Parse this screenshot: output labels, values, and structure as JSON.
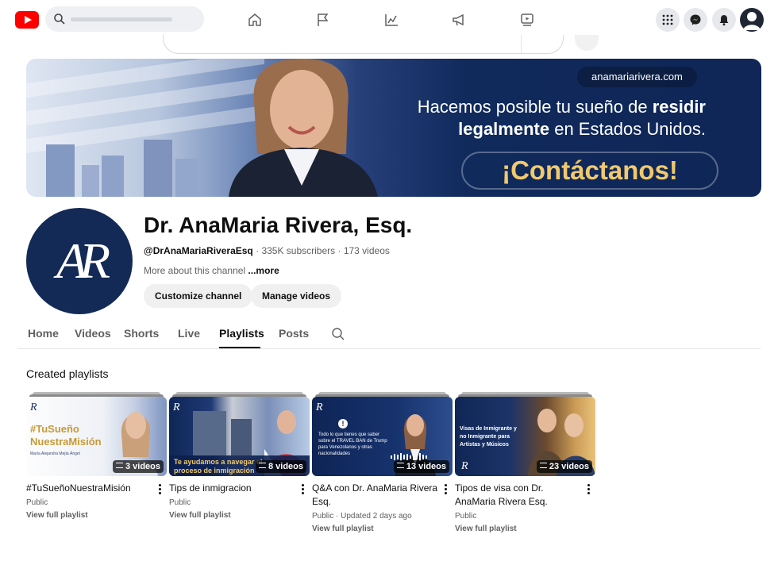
{
  "topbar": {
    "icons": [
      "youtube-logo",
      "search-icon",
      "home-icon",
      "flag-icon",
      "analytics-icon",
      "megaphone-icon",
      "video-icon",
      "apps-grid-icon",
      "messenger-icon",
      "bell-icon",
      "account-icon"
    ]
  },
  "banner": {
    "url": "anamariarivera.com",
    "line1_pre": "Hacemos posible tu sueño de ",
    "line1_bold": "residir",
    "line2_bold": "legalmente",
    "line2_post": " en Estados Unidos.",
    "cta": "¡Contáctanos!"
  },
  "channel": {
    "avatar_letters": "AR",
    "name": "Dr. AnaMaria Rivera, Esq.",
    "handle": "@DrAnaMariaRiveraEsq",
    "separator": " · ",
    "subscribers": "335K subscribers",
    "videos": "173 videos",
    "more_prefix": "More about this channel ",
    "more_link": "...more",
    "customize_label": "Customize channel",
    "manage_label": "Manage videos"
  },
  "tabs": [
    {
      "label": "Home"
    },
    {
      "label": "Videos"
    },
    {
      "label": "Shorts"
    },
    {
      "label": "Live"
    },
    {
      "label": "Playlists"
    },
    {
      "label": "Posts"
    }
  ],
  "active_tab": "Playlists",
  "section_title": "Created playlists",
  "playlists": [
    {
      "title": "#TuSueñoNuestraMisión",
      "visibility": "Public",
      "updated": "",
      "count": "3 videos",
      "link": "View full playlist",
      "thumb_text": "#TuSueño NuestraMisión",
      "thumb_sub": "María Alejandra Mejía Ángel"
    },
    {
      "title": "Tips de inmigracion",
      "visibility": "Public",
      "updated": "",
      "count": "8 videos",
      "link": "View full playlist",
      "thumb_text": "Te ayudamos a navegar el proceso de inmigración"
    },
    {
      "title": "Q&A con Dr. AnaMaria Rivera Esq.",
      "visibility": "Public",
      "updated": "Updated 2 days ago",
      "count": "13 videos",
      "link": "View full playlist",
      "thumb_text": "Todo lo que tienes que saber sobre el TRAVEL BAN de Trump para Venezolanos y otras nacionalidades"
    },
    {
      "title": "Tipos de visa con Dr. AnaMaria Rivera Esq.",
      "visibility": "Public",
      "updated": "",
      "count": "23 videos",
      "link": "View full playlist",
      "thumb_text": "Visas de Inmigrante y no Inmigrante para Artistas y Músicos"
    }
  ]
}
